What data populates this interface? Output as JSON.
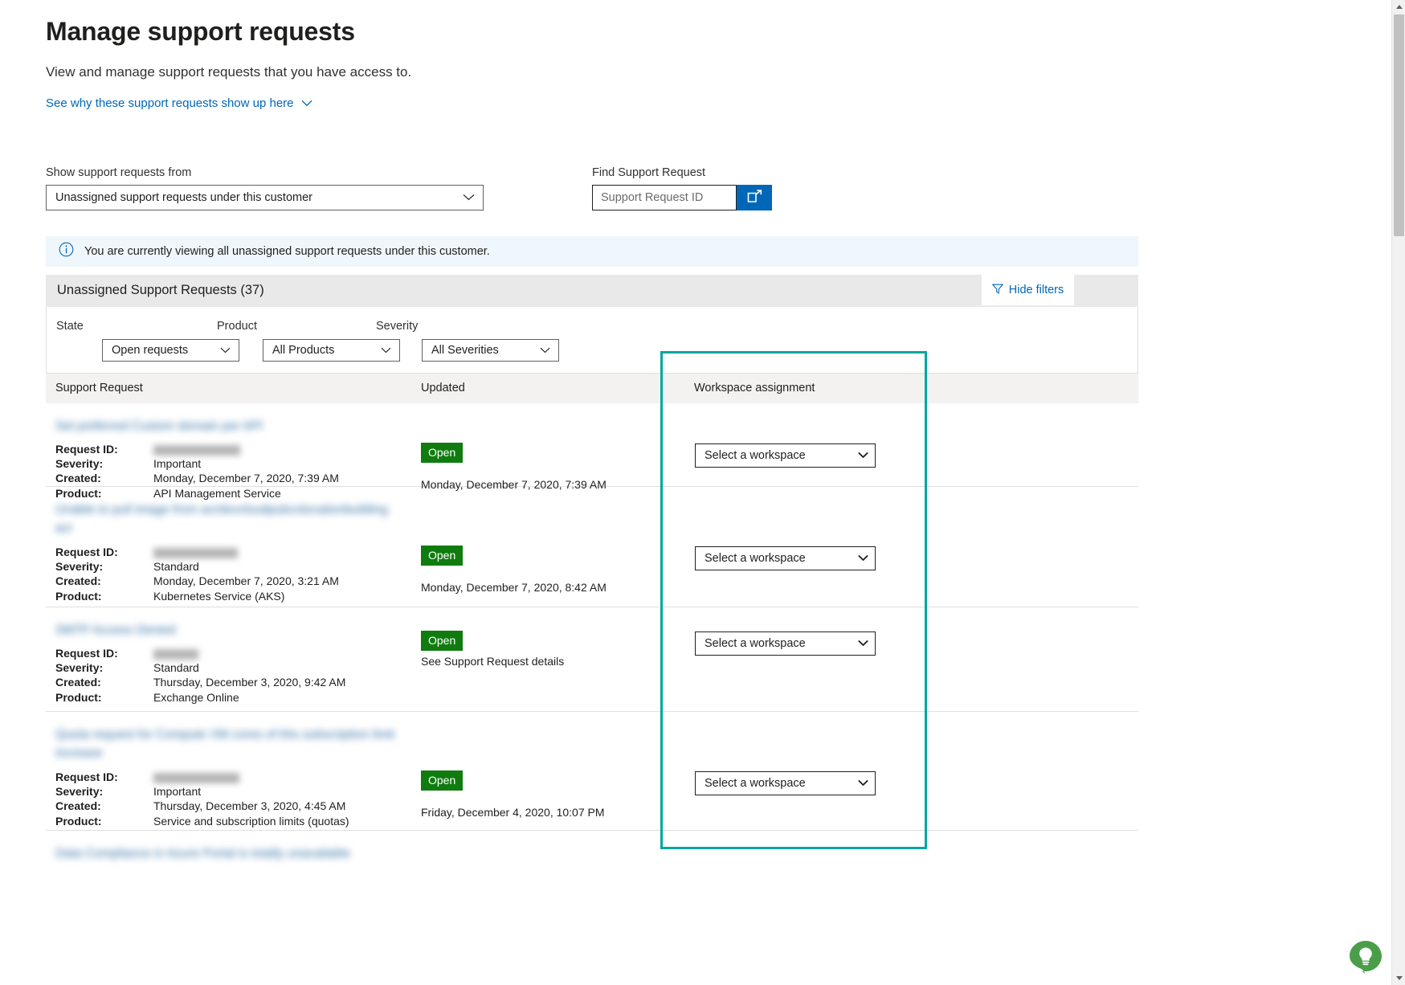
{
  "header": {
    "title": "Manage support requests",
    "subtitle": "View and manage support requests that you have access to.",
    "why_link": "See why these support requests show up here"
  },
  "controls": {
    "show_from_label": "Show support requests from",
    "show_from_value": "Unassigned support requests under this customer",
    "find_label": "Find Support Request",
    "find_placeholder": "Support Request ID",
    "find_value": "",
    "find_button_icon": "open-in-new-window-icon"
  },
  "banner": {
    "icon": "info-icon",
    "text": "You are currently viewing all unassigned support requests under this customer."
  },
  "panel": {
    "title": "Unassigned Support Requests (37)",
    "hide_filters_label": "Hide filters",
    "hide_filters_icon": "filter-icon"
  },
  "filters": [
    {
      "label": "State",
      "value": "Open requests"
    },
    {
      "label": "Product",
      "value": "All Products"
    },
    {
      "label": "Severity",
      "value": "All Severities"
    }
  ],
  "table": {
    "columns": [
      "Support Request",
      "Updated",
      "Workspace assignment"
    ],
    "meta_keys": {
      "request_id": "Request ID:",
      "severity": "Severity:",
      "created": "Created:",
      "product": "Product:"
    },
    "workspace_placeholder": "Select a workspace",
    "status_open": "Open",
    "rows": [
      {
        "title": "Set preferred Custom domain per API",
        "title_redacted": true,
        "request_id": "",
        "request_id_redacted": true,
        "severity": "Important",
        "created": "Monday, December 7, 2020, 7:39 AM",
        "product": "API Management Service",
        "status": "Open",
        "updated": "Monday, December 7, 2020, 7:39 AM",
        "updated_is_link": false,
        "workspace": "Select a workspace"
      },
      {
        "title": "Unable to pull image from acrdevcloudpubcolocationbuilding acr",
        "title_redacted": true,
        "request_id": "",
        "request_id_redacted": true,
        "severity": "Standard",
        "created": "Monday, December 7, 2020, 3:21 AM",
        "product": "Kubernetes Service (AKS)",
        "status": "Open",
        "updated": "Monday, December 7, 2020, 8:42 AM",
        "updated_is_link": false,
        "workspace": "Select a workspace"
      },
      {
        "title": "SMTP Access Denied",
        "title_redacted": true,
        "request_id": "",
        "request_id_redacted": true,
        "severity": "Standard",
        "created": "Thursday, December 3, 2020, 9:42 AM",
        "product": "Exchange Online",
        "status": "Open",
        "updated": "See Support Request details",
        "updated_is_link": true,
        "workspace": "Select a workspace"
      },
      {
        "title": "Quota request for Compute VM cores of this subscription limit increase",
        "title_redacted": true,
        "request_id": "",
        "request_id_redacted": true,
        "severity": "Important",
        "created": "Thursday, December 3, 2020, 4:45 AM",
        "product": "Service and subscription limits (quotas)",
        "status": "Open",
        "updated": "Friday, December 4, 2020, 10:07 PM",
        "updated_is_link": false,
        "workspace": "Select a workspace"
      },
      {
        "title": "Data Compliance in Azure Portal is totally unavailable",
        "title_redacted": true,
        "partial": true
      }
    ]
  },
  "overlay": {
    "highlight_color": "#00a79d"
  },
  "feedback": {
    "icon": "feedback-lightbulb-icon",
    "color": "#4a9e4a"
  },
  "scrollbar": {
    "up_icon": "scroll-up-arrow-icon",
    "down_icon": "scroll-down-arrow-icon"
  }
}
